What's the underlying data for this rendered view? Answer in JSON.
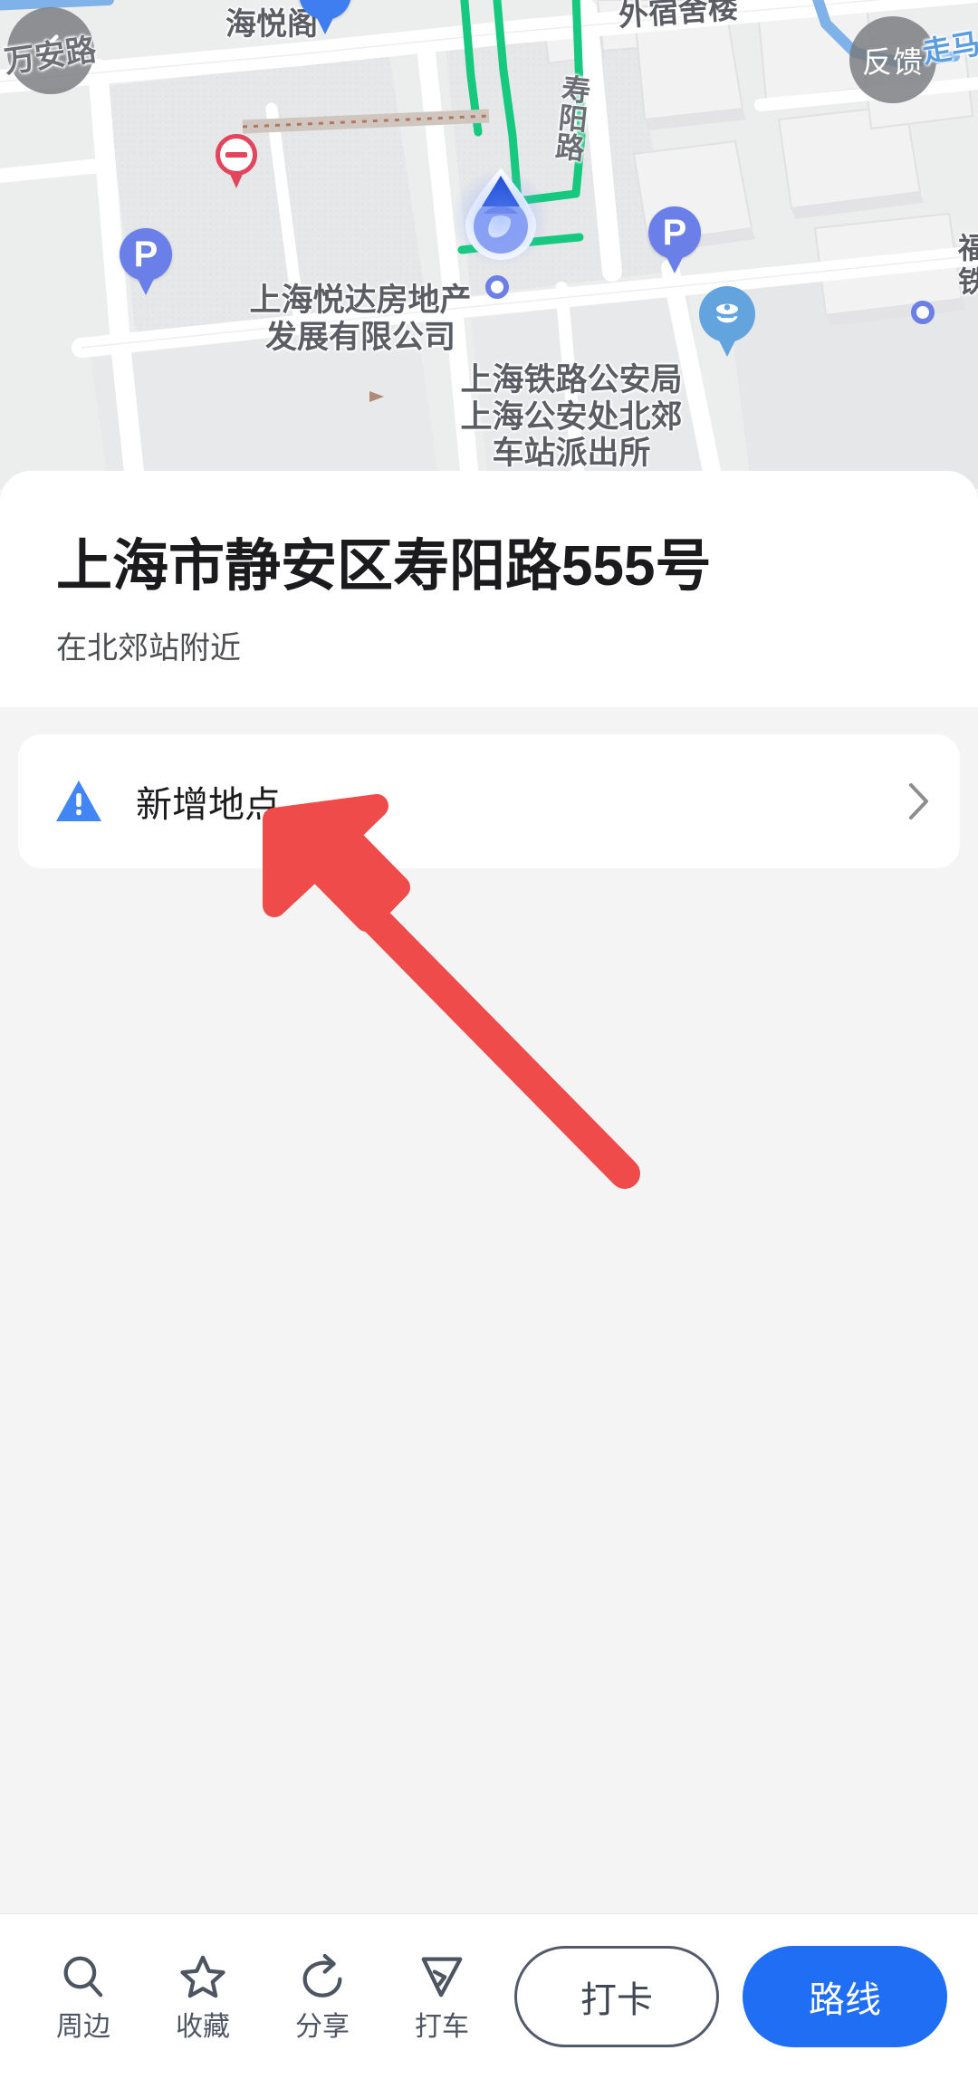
{
  "map": {
    "back_button": {
      "icon": "chevron-left-icon"
    },
    "feedback_button": {
      "label": "反馈"
    },
    "labels": [
      {
        "name": "wan-an-road",
        "text": "万安路",
        "kind": "street"
      },
      {
        "name": "hai-yue-ge",
        "text": "海悦阁",
        "kind": "poi"
      },
      {
        "name": "wai-su-she-lou",
        "text": "外宿舍楼",
        "kind": "poi"
      },
      {
        "name": "shou-yang-road",
        "text": "寿阳路",
        "kind": "street"
      },
      {
        "name": "zou-ma-road",
        "text": "走马",
        "kind": "street-blue"
      },
      {
        "name": "yueda-real-estate",
        "text": "上海悦达房地产\n发展有限公司",
        "kind": "poi"
      },
      {
        "name": "railway-police-station",
        "text": "上海铁路公安局\n上海公安处北郊\n车站派出所",
        "kind": "poi"
      }
    ],
    "pins": [
      {
        "name": "parking-pin-left",
        "glyph": "P"
      },
      {
        "name": "parking-pin-right",
        "glyph": "P"
      },
      {
        "name": "no-entry-pin",
        "glyph": "no-entry-icon"
      },
      {
        "name": "police-pin",
        "glyph": "police-icon"
      },
      {
        "name": "current-location-marker",
        "glyph": "location-droplet-icon"
      }
    ],
    "colors": {
      "background": "#eceded",
      "road": "#ffffff",
      "green_route": "#16c97e",
      "blue_road": "#7fb2e8",
      "pin_blue": "#6a7fe8",
      "pin_red": "#e2455c",
      "police_blue": "#63a4de"
    }
  },
  "sheet": {
    "title": "上海市静安区寿阳路555号",
    "subtitle": "在北郊站附近",
    "add_place_row": {
      "label": "新增地点",
      "warning_icon": "warning-triangle-icon",
      "chevron_icon": "chevron-right-icon"
    }
  },
  "annotation": {
    "arrow": {
      "name": "red-pointer-arrow",
      "color": "#ef4b4b"
    }
  },
  "bottom_bar": {
    "tools": [
      {
        "name": "nearby",
        "icon": "search-icon",
        "label": "周边"
      },
      {
        "name": "favorite",
        "icon": "star-icon",
        "label": "收藏"
      },
      {
        "name": "share",
        "icon": "share-icon",
        "label": "分享"
      },
      {
        "name": "taxi",
        "icon": "navigation-arrow-icon",
        "label": "打车"
      }
    ],
    "checkin_button": {
      "label": "打卡"
    },
    "route_button": {
      "label": "路线"
    },
    "colors": {
      "primary": "#1f6ef4",
      "outline_border": "#525a6b",
      "icon": "#4e5562"
    }
  }
}
